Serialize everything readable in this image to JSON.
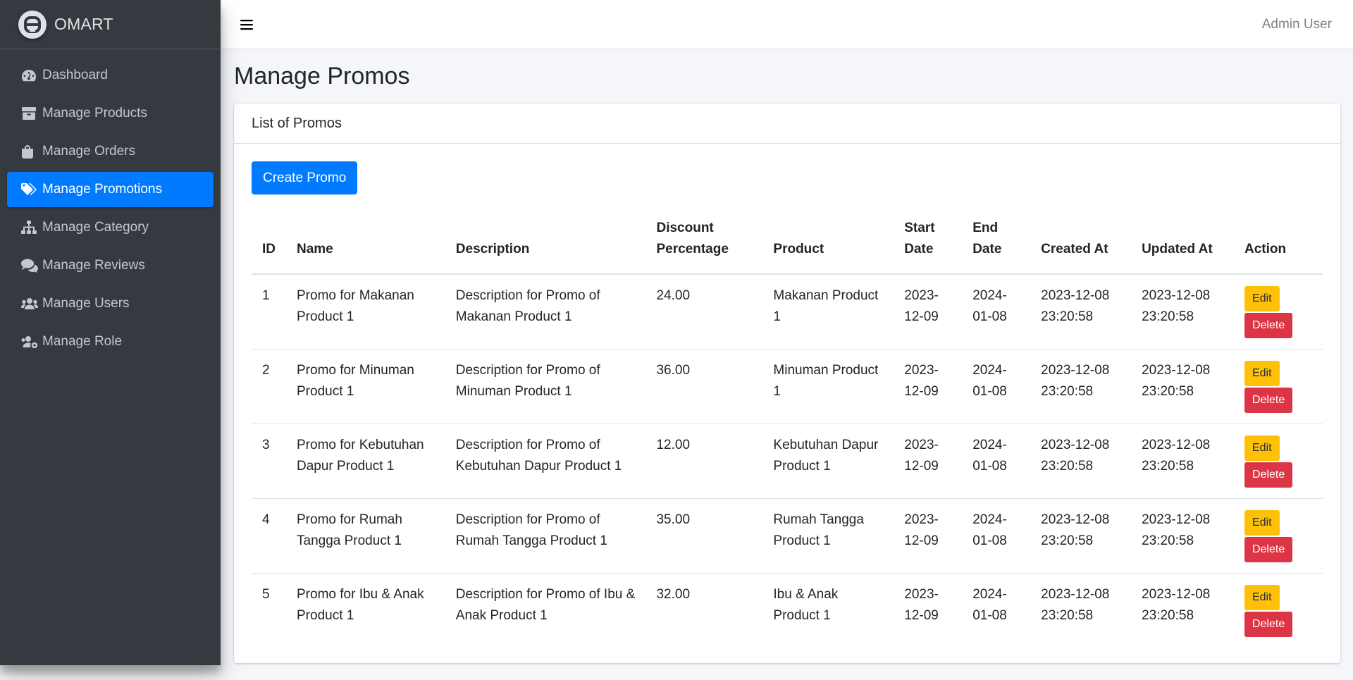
{
  "brand": {
    "name": "OMART"
  },
  "sidebar": {
    "items": [
      {
        "label": "Dashboard",
        "icon": "tachometer-icon",
        "active": false
      },
      {
        "label": "Manage Products",
        "icon": "box-icon",
        "active": false
      },
      {
        "label": "Manage Orders",
        "icon": "shopping-bag-icon",
        "active": false
      },
      {
        "label": "Manage Promotions",
        "icon": "tags-icon",
        "active": true
      },
      {
        "label": "Manage Category",
        "icon": "sitemap-icon",
        "active": false
      },
      {
        "label": "Manage Reviews",
        "icon": "comments-icon",
        "active": false
      },
      {
        "label": "Manage Users",
        "icon": "users-icon",
        "active": false
      },
      {
        "label": "Manage Role",
        "icon": "users-cog-icon",
        "active": false
      }
    ]
  },
  "topbar": {
    "user": "Admin User",
    "menu_icon": "bars-icon"
  },
  "page": {
    "title": "Manage Promos"
  },
  "card": {
    "header": "List of Promos",
    "create_label": "Create Promo"
  },
  "table": {
    "headers": {
      "id": "ID",
      "name": "Name",
      "description": "Description",
      "discount_1": "Discount",
      "discount_2": "Percentage",
      "product": "Product",
      "start_1": "Start",
      "start_2": "Date",
      "end_1": "End",
      "end_2": "Date",
      "created": "Created At",
      "updated": "Updated At",
      "action": "Action"
    },
    "edit_label": "Edit",
    "delete_label": "Delete",
    "rows": [
      {
        "id": "1",
        "name_1": "Promo for Makanan",
        "name_2": "Product 1",
        "desc_1": "Description for Promo of",
        "desc_2": "Makanan Product 1",
        "discount": "24.00",
        "product_1": "Makanan Product",
        "product_2": "1",
        "start_1": "2023-",
        "start_2": "12-09",
        "end_1": "2024-",
        "end_2": "01-08",
        "created_1": "2023-12-08",
        "created_2": "23:20:58",
        "updated_1": "2023-12-08",
        "updated_2": "23:20:58"
      },
      {
        "id": "2",
        "name_1": "Promo for Minuman",
        "name_2": "Product 1",
        "desc_1": "Description for Promo of",
        "desc_2": "Minuman Product 1",
        "discount": "36.00",
        "product_1": "Minuman Product",
        "product_2": "1",
        "start_1": "2023-",
        "start_2": "12-09",
        "end_1": "2024-",
        "end_2": "01-08",
        "created_1": "2023-12-08",
        "created_2": "23:20:58",
        "updated_1": "2023-12-08",
        "updated_2": "23:20:58"
      },
      {
        "id": "3",
        "name_1": "Promo for Kebutuhan",
        "name_2": "Dapur Product 1",
        "desc_1": "Description for Promo of",
        "desc_2": "Kebutuhan Dapur Product 1",
        "discount": "12.00",
        "product_1": "Kebutuhan Dapur",
        "product_2": "Product 1",
        "start_1": "2023-",
        "start_2": "12-09",
        "end_1": "2024-",
        "end_2": "01-08",
        "created_1": "2023-12-08",
        "created_2": "23:20:58",
        "updated_1": "2023-12-08",
        "updated_2": "23:20:58"
      },
      {
        "id": "4",
        "name_1": "Promo for Rumah",
        "name_2": "Tangga Product 1",
        "desc_1": "Description for Promo of",
        "desc_2": "Rumah Tangga Product 1",
        "discount": "35.00",
        "product_1": "Rumah Tangga",
        "product_2": "Product 1",
        "start_1": "2023-",
        "start_2": "12-09",
        "end_1": "2024-",
        "end_2": "01-08",
        "created_1": "2023-12-08",
        "created_2": "23:20:58",
        "updated_1": "2023-12-08",
        "updated_2": "23:20:58"
      },
      {
        "id": "5",
        "name_1": "Promo for Ibu & Anak",
        "name_2": "Product 1",
        "desc_1": "Description for Promo of Ibu &",
        "desc_2": "Anak Product 1",
        "discount": "32.00",
        "product_1": "Ibu & Anak",
        "product_2": "Product 1",
        "start_1": "2023-",
        "start_2": "12-09",
        "end_1": "2024-",
        "end_2": "01-08",
        "created_1": "2023-12-08",
        "created_2": "23:20:58",
        "updated_1": "2023-12-08",
        "updated_2": "23:20:58"
      }
    ]
  },
  "colors": {
    "sidebar_bg": "#343a40",
    "primary": "#007bff",
    "warning": "#ffc107",
    "danger": "#dc3545",
    "page_bg": "#f4f6f9"
  }
}
